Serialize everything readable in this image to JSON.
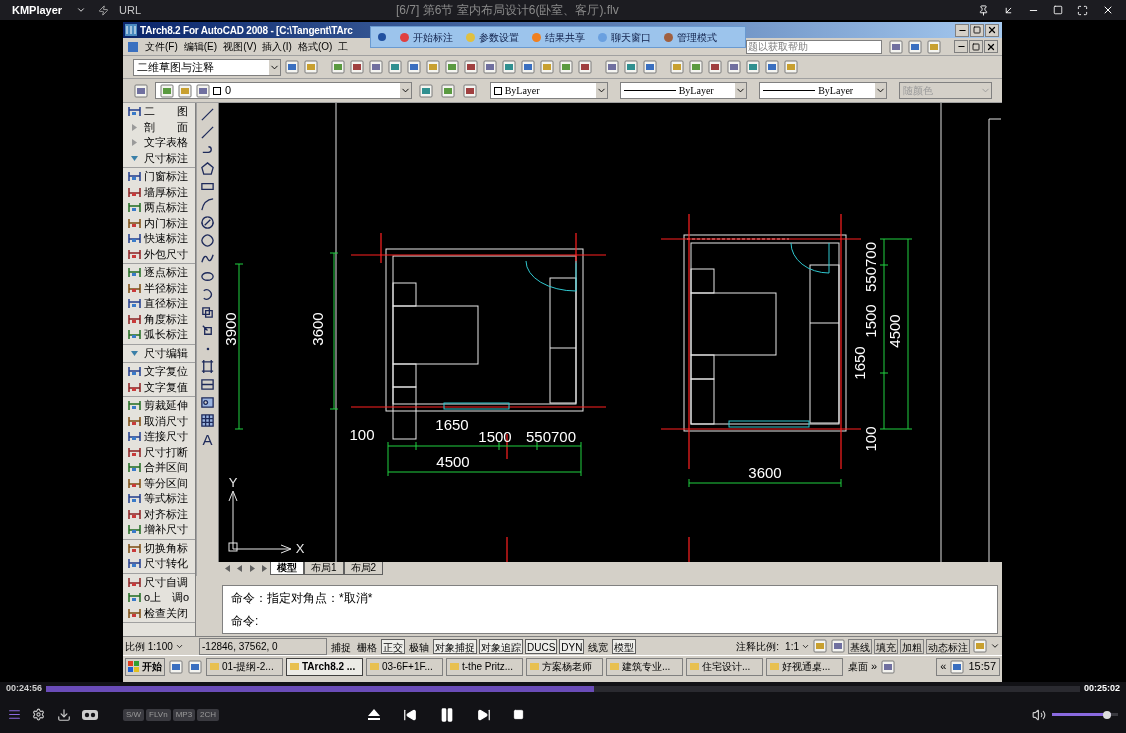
{
  "player": {
    "logo": "KMPlayer",
    "url_label": "URL",
    "title": "[6/7] 第6节  室内布局设计6(卧室、客厅).flv"
  },
  "cad": {
    "title": "TArch8.2 For AutoCAD 2008 - [C:\\Tangent\\TArc",
    "popup": [
      "开始标注",
      "参数设置",
      "结果共享",
      "聊天窗口",
      "管理模式"
    ],
    "menu": [
      "文件(F)",
      "编辑(E)",
      "视图(V)",
      "插入(I)",
      "格式(O)",
      "工"
    ],
    "help_search": "题以获取帮助",
    "workspace": "二维草图与注释",
    "layer": "0",
    "properties": [
      {
        "label": "ByLayer",
        "kind": "color",
        "disabled": false
      },
      {
        "label": "ByLayer",
        "kind": "line",
        "disabled": false
      },
      {
        "label": "ByLayer",
        "kind": "line",
        "disabled": false
      },
      {
        "label": "随颜色",
        "kind": "plain",
        "disabled": true
      }
    ],
    "panel": [
      {
        "items": [
          {
            "label": "二　　图",
            "kind": "tool"
          },
          {
            "label": "剖　　面",
            "kind": "header",
            "expanded": false
          },
          {
            "label": "文字表格",
            "kind": "header",
            "expanded": false
          },
          {
            "label": "尺寸标注",
            "kind": "header",
            "expanded": true
          }
        ]
      },
      {
        "items": [
          {
            "label": "门窗标注",
            "kind": "tool"
          },
          {
            "label": "墙厚标注",
            "kind": "tool"
          },
          {
            "label": "两点标注",
            "kind": "tool"
          },
          {
            "label": "内门标注",
            "kind": "tool"
          },
          {
            "label": "快速标注",
            "kind": "tool"
          },
          {
            "label": "外包尺寸",
            "kind": "tool"
          }
        ]
      },
      {
        "items": [
          {
            "label": "逐点标注",
            "kind": "tool"
          },
          {
            "label": "半径标注",
            "kind": "tool"
          },
          {
            "label": "直径标注",
            "kind": "tool"
          },
          {
            "label": "角度标注",
            "kind": "tool"
          },
          {
            "label": "弧长标注",
            "kind": "tool"
          }
        ]
      },
      {
        "items": [
          {
            "label": "尺寸编辑",
            "kind": "header",
            "expanded": true
          }
        ]
      },
      {
        "items": [
          {
            "label": "文字复位",
            "kind": "tool"
          },
          {
            "label": "文字复值",
            "kind": "tool"
          }
        ]
      },
      {
        "items": [
          {
            "label": "剪裁延伸",
            "kind": "tool"
          },
          {
            "label": "取消尺寸",
            "kind": "tool"
          },
          {
            "label": "连接尺寸",
            "kind": "tool"
          },
          {
            "label": "尺寸打断",
            "kind": "tool"
          },
          {
            "label": "合并区间",
            "kind": "tool"
          },
          {
            "label": "等分区间",
            "kind": "tool"
          },
          {
            "label": "等式标注",
            "kind": "tool"
          },
          {
            "label": "对齐标注",
            "kind": "tool"
          },
          {
            "label": "增补尺寸",
            "kind": "tool"
          }
        ]
      },
      {
        "items": [
          {
            "label": "切换角标",
            "kind": "tool"
          },
          {
            "label": "尺寸转化",
            "kind": "tool"
          }
        ]
      },
      {
        "items": [
          {
            "label": "尺寸自调",
            "kind": "tool"
          },
          {
            "label": "o上　调o",
            "kind": "tool"
          },
          {
            "label": "检查关闭",
            "kind": "tool"
          }
        ]
      }
    ],
    "draw_tool_text": "A",
    "tabs": [
      {
        "label": "模型",
        "selected": true
      },
      {
        "label": "布局1",
        "selected": false
      },
      {
        "label": "布局2",
        "selected": false
      }
    ],
    "command_lines": [
      "命令：指定对角点：*取消*",
      "命令:"
    ],
    "status": {
      "scale": "比例 1:100",
      "coords": "-12846, 37562, 0",
      "toggles": [
        {
          "label": "捕捉",
          "on": false
        },
        {
          "label": "栅格",
          "on": false
        },
        {
          "label": "正交",
          "on": true
        },
        {
          "label": "极轴",
          "on": false
        },
        {
          "label": "对象捕捉",
          "on": true
        },
        {
          "label": "对象追踪",
          "on": true
        },
        {
          "label": "DUCS",
          "on": true
        },
        {
          "label": "DYN",
          "on": true
        },
        {
          "label": "线宽",
          "on": false
        },
        {
          "label": "模型",
          "on": true
        }
      ],
      "annotation_label": "注释比例:",
      "annotation_scale": "1:1",
      "tarch_buttons": [
        "基线",
        "填充",
        "加粗",
        "动态标注"
      ]
    },
    "taskbar": {
      "start": "开始",
      "tasks": [
        {
          "label": "01-提纲-2...",
          "selected": false
        },
        {
          "label": "TArch8.2 ...",
          "selected": true
        },
        {
          "label": "03-6F+1F...",
          "selected": false
        },
        {
          "label": "t-the Pritz...",
          "selected": false
        },
        {
          "label": "方案杨老师",
          "selected": false
        },
        {
          "label": "建筑专业...",
          "selected": false
        },
        {
          "label": "住宅设计...",
          "selected": false
        },
        {
          "label": "好视通桌...",
          "selected": false
        }
      ],
      "desktop": "桌面",
      "more": "»",
      "tray_expand": "«",
      "clock": "15:57"
    }
  },
  "drawing": {
    "left_plan_dims": [
      "3900",
      "3600",
      "100",
      "1650",
      "1500",
      "550700",
      "4500"
    ],
    "right_plan_dims": [
      "550700",
      "1500",
      "4500",
      "1650",
      "100",
      "3600"
    ],
    "ucs": [
      "Y",
      "X"
    ]
  },
  "playback": {
    "elapsed": "00:24:56",
    "total": "00:25:02",
    "level": 0.53,
    "playing": true,
    "badges": [
      "S/W",
      "FLVn",
      "MP3",
      "2CH"
    ],
    "volume": {
      "level": 0.9
    }
  }
}
